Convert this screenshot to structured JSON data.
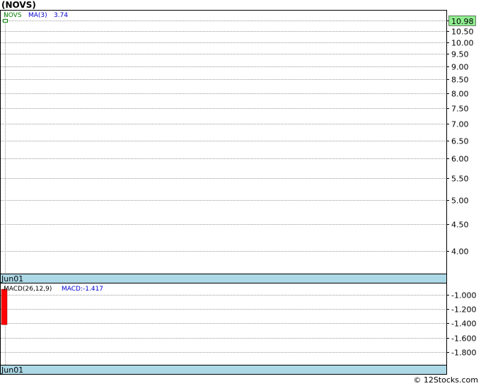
{
  "title": "(NOVS)",
  "watermark": "© 12Stocks.com",
  "colors": {
    "grid": "#9a9a9a",
    "date_strip": "#add8e6",
    "candle": "#008000",
    "price_badge_bg": "#90ee90",
    "macd_bar": "#ff0000",
    "legend_symbol": "#008000",
    "legend_ma": "#0000cd",
    "legend_macd": "#0000cd"
  },
  "chart_data": [
    {
      "type": "line",
      "name": "price",
      "symbol_label": "NOVS",
      "ma_label": "MA(3)",
      "ma_value": "3.74",
      "last_price_label": "10.98",
      "last_price": 10.98,
      "y_scale": "log",
      "y_ticks": [
        {
          "value": 11.0,
          "label": "11.00"
        },
        {
          "value": 10.5,
          "label": "10.50"
        },
        {
          "value": 10.0,
          "label": "10.00"
        },
        {
          "value": 9.5,
          "label": "9.50"
        },
        {
          "value": 9.0,
          "label": "9.00"
        },
        {
          "value": 8.5,
          "label": "8.50"
        },
        {
          "value": 8.0,
          "label": "8.00"
        },
        {
          "value": 7.5,
          "label": "7.50"
        },
        {
          "value": 7.0,
          "label": "7.00"
        },
        {
          "value": 6.5,
          "label": "6.50"
        },
        {
          "value": 6.0,
          "label": "6.00"
        },
        {
          "value": 5.5,
          "label": "5.50"
        },
        {
          "value": 5.0,
          "label": "5.00"
        },
        {
          "value": 4.5,
          "label": "4.50"
        },
        {
          "value": 4.0,
          "label": "4.00"
        }
      ],
      "ylim": [
        3.62,
        11.5
      ],
      "x_label": "Jun01",
      "candles": [
        {
          "open": 10.98,
          "high": 10.98,
          "low": 10.98,
          "close": 10.98
        }
      ]
    },
    {
      "type": "bar",
      "name": "macd",
      "label": "MACD(26,12,9)",
      "value_label": "MACD:-1.417",
      "y_ticks": [
        {
          "value": -1.0,
          "label": "-1.000"
        },
        {
          "value": -1.2,
          "label": "-1.200"
        },
        {
          "value": -1.4,
          "label": "-1.400"
        },
        {
          "value": -1.6,
          "label": "-1.600"
        },
        {
          "value": -1.8,
          "label": "-1.800"
        }
      ],
      "ylim": [
        -1.98,
        -0.84
      ],
      "x_label": "Jun01",
      "bars": [
        {
          "top": -0.92,
          "bottom": -1.417
        }
      ]
    }
  ]
}
